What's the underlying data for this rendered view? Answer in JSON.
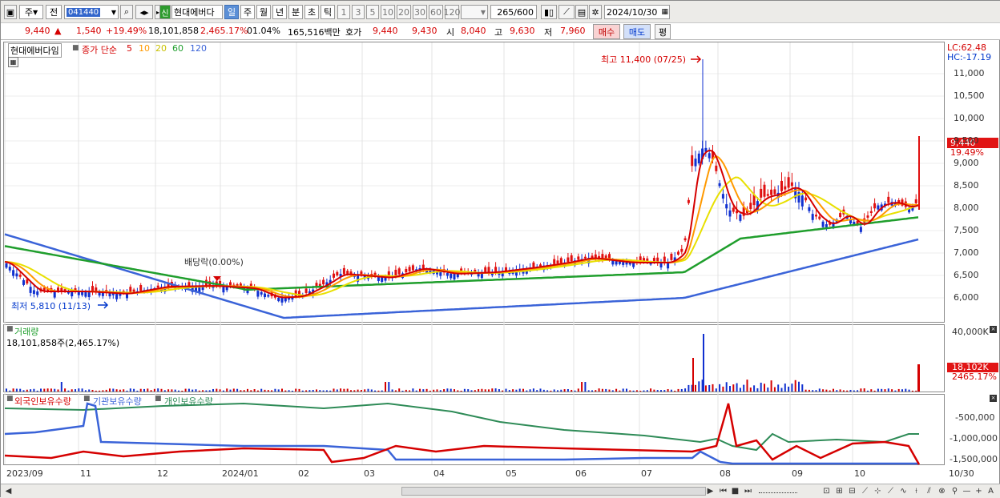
{
  "toolbar": {
    "market": "주",
    "period": "전",
    "code": "041440",
    "stock_name": "현대에버다",
    "sin": "신",
    "timeframes": [
      "일",
      "주",
      "월",
      "년",
      "분",
      "초",
      "틱"
    ],
    "ranges": [
      "1",
      "3",
      "5",
      "10",
      "20",
      "30",
      "60",
      "120"
    ],
    "count": "265",
    "count_total": "/600",
    "date": "2024/10/30"
  },
  "quote": {
    "price": "9,440",
    "arrow": "▲",
    "change": "1,540",
    "change_pct": "+19.49%",
    "volume": "18,101,858",
    "volume_ratio": "2,465.17%",
    "turnover": "01.04%",
    "amount": "165,516백만",
    "hoga_label": "호가",
    "ask": "9,440",
    "bid": "9,430",
    "open_label": "시",
    "open": "8,040",
    "high_label": "고",
    "high": "9,630",
    "low_label": "저",
    "low": "7,960",
    "buy": "매수",
    "sell": "매도",
    "avg": "평"
  },
  "panel_price": {
    "title": "현대에버다임",
    "ma_label": "종가 단순",
    "ma": [
      "5",
      "10",
      "20",
      "60",
      "120"
    ],
    "ma_colors": [
      "#d50000",
      "#ff9900",
      "#e8e000",
      "#1f9e2c",
      "#3a63d8"
    ],
    "lc": "LC:62.48",
    "hc": "HC:-17.19",
    "max_label": "최고 11,400 (07/25)",
    "min_label": "최저 5,810 (11/13)",
    "div_label": "배당락(0.00%)",
    "last_price": "9,440",
    "last_pct": "19.49%",
    "yticks": [
      "11,000",
      "10,500",
      "10,000",
      "9,500",
      "9,000",
      "8,500",
      "8,000",
      "7,500",
      "7,000",
      "6,500",
      "6,000"
    ]
  },
  "panel_volume": {
    "title": "거래량",
    "summary": "18,101,858주(2,465.17%)",
    "ytick": "40,000K",
    "last": "18,102K",
    "last_pct": "2465.17%"
  },
  "panel_holding": {
    "series": [
      "외국인보유수량",
      "기관보유수량",
      "개인보유수량"
    ],
    "series_colors": [
      "#d50000",
      "#3a63d8",
      "#2e8b57"
    ],
    "yticks": [
      "-500,000",
      "-1,000,000",
      "-1,500,000"
    ]
  },
  "xaxis": [
    "2023/09",
    "11",
    "12",
    "2024/01",
    "02",
    "03",
    "04",
    "05",
    "06",
    "07",
    "08",
    "09",
    "10",
    "10/30"
  ]
}
